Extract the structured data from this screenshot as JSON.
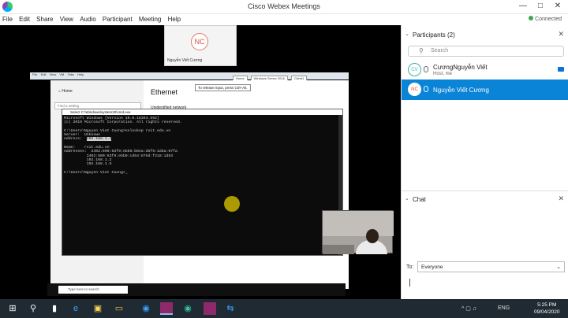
{
  "app": {
    "title": "Cisco Webex Meetings",
    "status": "Connected"
  },
  "menu": [
    "File",
    "Edit",
    "Share",
    "View",
    "Audio",
    "Participant",
    "Meeting",
    "Help"
  ],
  "thumbnail": {
    "initials": "NC",
    "name": "Nguyễn Viết Cương"
  },
  "remote": {
    "toolbar": [
      "File",
      "Edit",
      "View",
      "VM",
      "Tabs",
      "Help"
    ],
    "tabs": [
      "Home",
      "Windows Server 2016",
      "Client1"
    ],
    "tooltip": "To release input, press Ctrl+Alt.",
    "settings": {
      "home": "Home",
      "find_placeholder": "Find a setting",
      "heading": "Ethernet",
      "sub": "Unidentified network"
    },
    "taskbar_search": "Type here to search"
  },
  "cmd": {
    "title": "Select C:\\Windows\\system32\\cmd.exe",
    "line1": "Microsoft Windows [Version 10.0.18363.592]",
    "line2": "(c) 2019 Microsoft Corporation. All rights reserved.",
    "line3": "C:\\Users\\Nguyen Viet Cuong>nslookup rvit.edu.vn",
    "line4": "Server:  Unknown",
    "line5_label": "Address:  ",
    "line5_value": "192.168.1.1",
    "line6": "Name:    rvit.edu.vn",
    "line7": "Addresses:  2402:800:63f9:ebb9:b6ea:d5f9:1d5a:97fa",
    "line8": "          2402:800:63f9:ebb9:cd54:876d:f218:1d83",
    "line9": "          192.168.1.2",
    "line10": "          192.168.1.5",
    "line11": "C:\\Users\\Nguyen Viet Cuong>"
  },
  "participants": {
    "header": "Participants (2)",
    "search_placeholder": "Search",
    "list": [
      {
        "initials": "CV",
        "name": "CươngNguyễn Viết",
        "role": "Host, me"
      },
      {
        "initials": "NC",
        "name": "Nguyễn Viết Cương"
      }
    ]
  },
  "chat": {
    "header": "Chat",
    "to_label": "To:",
    "to_value": "Everyone"
  },
  "taskbar": {
    "lang": "ENG",
    "time": "5:25 PM",
    "date": "09/04/2020"
  }
}
